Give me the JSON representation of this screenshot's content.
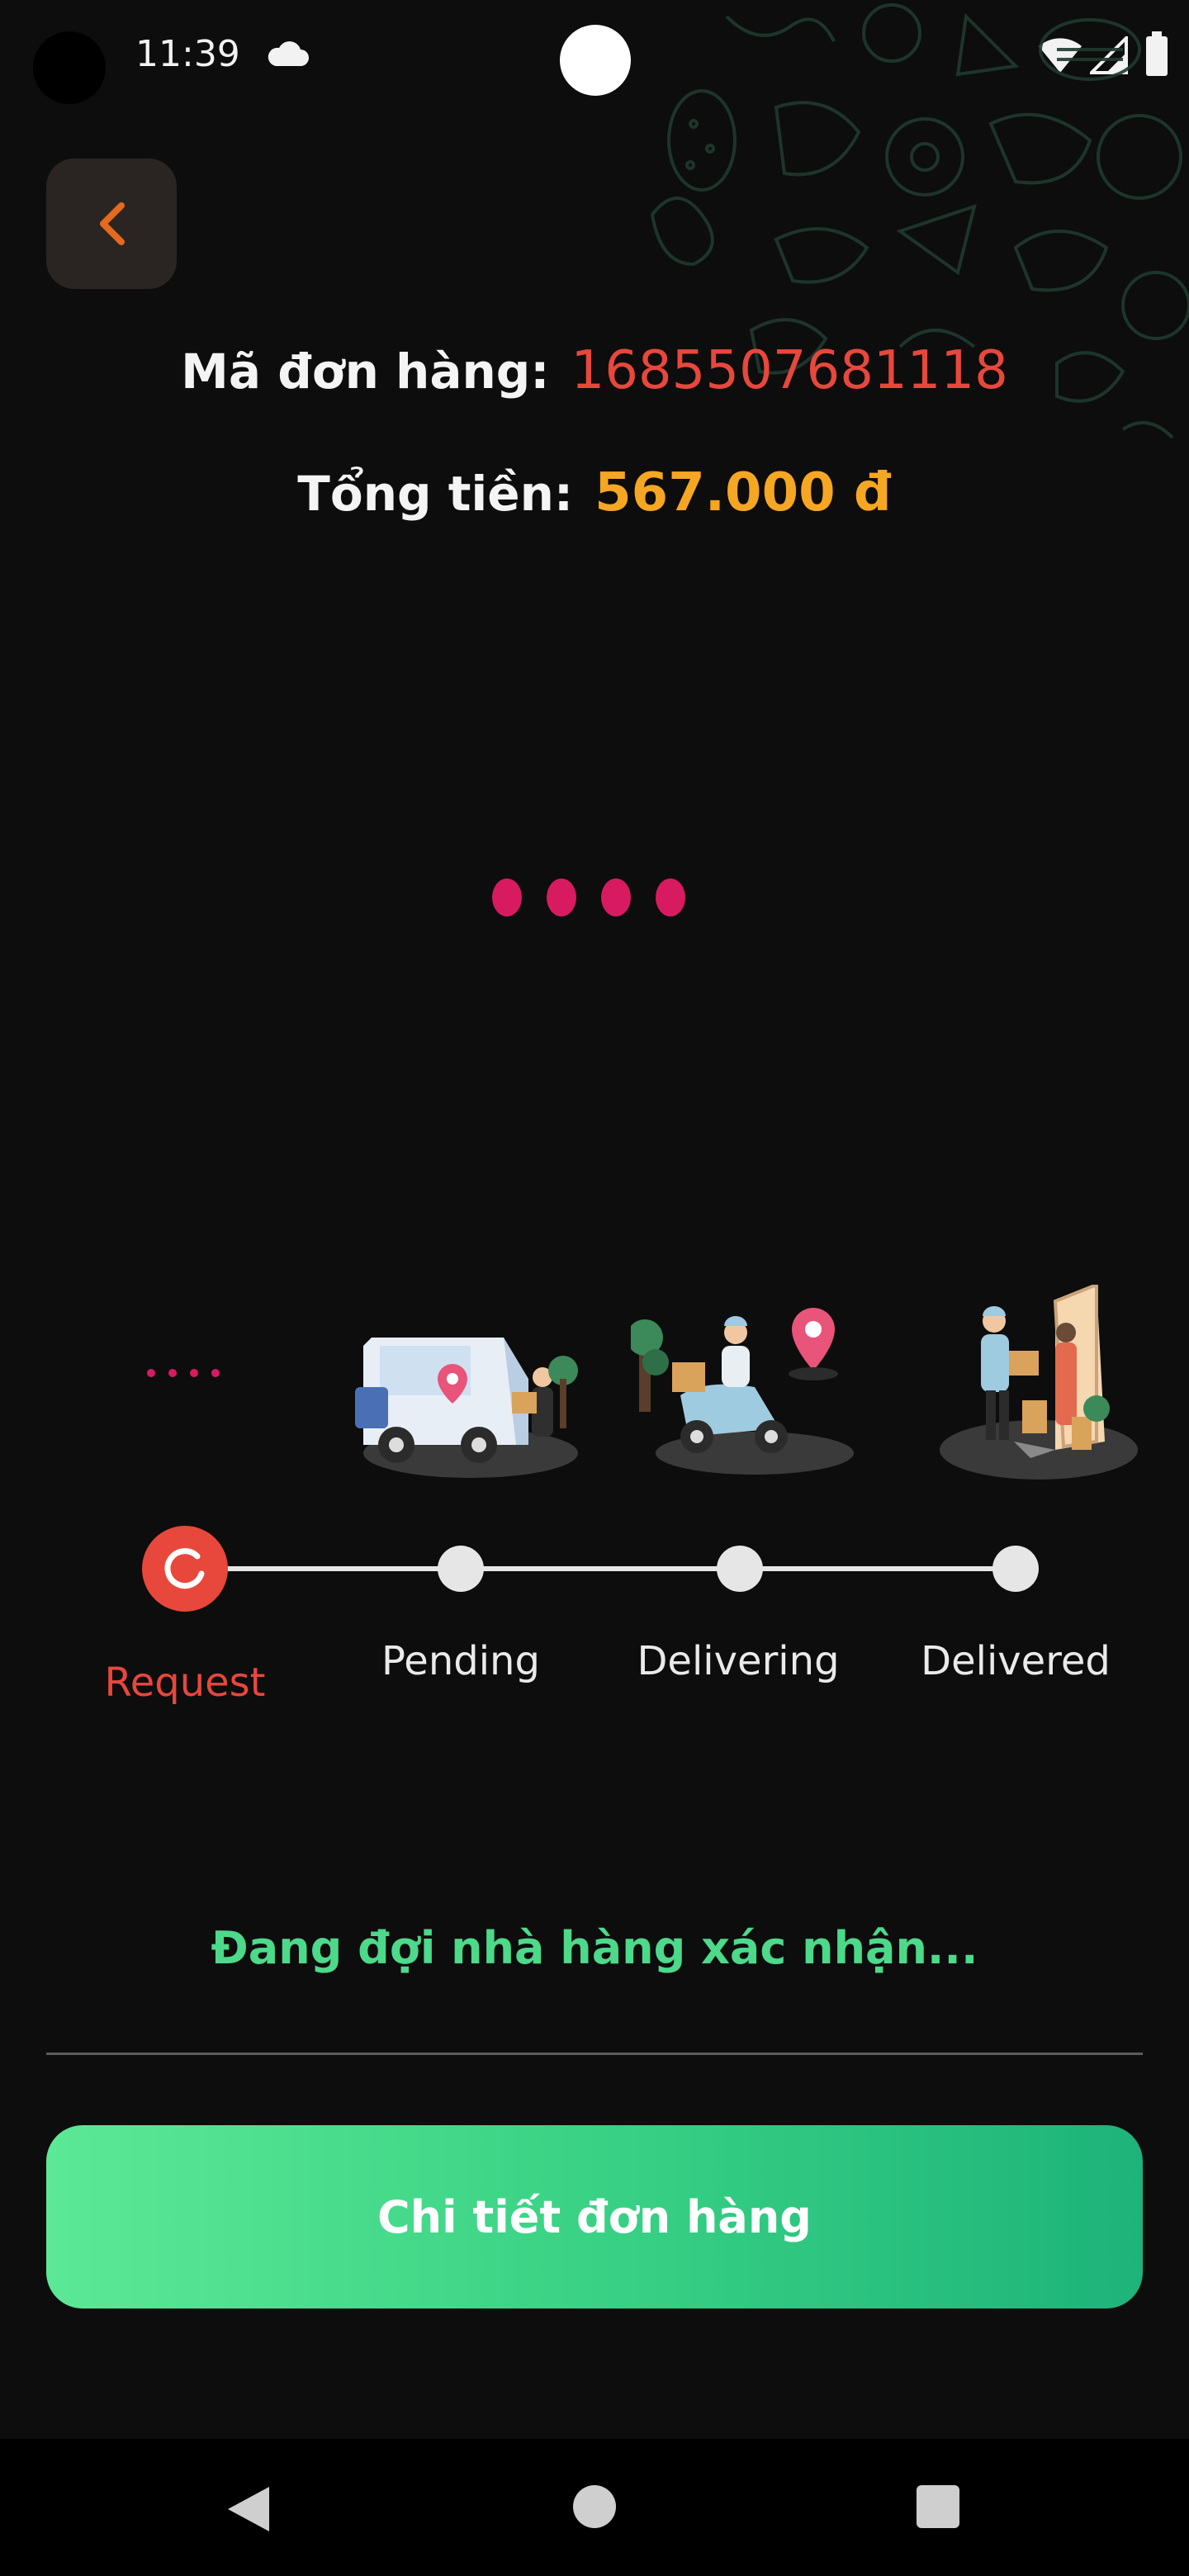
{
  "status_bar": {
    "time": "11:39",
    "icons": [
      "cloud-icon",
      "wifi-icon",
      "signal-icon",
      "battery-icon"
    ]
  },
  "header": {
    "back_icon": "chevron-left-icon"
  },
  "order": {
    "code_label": "Mã đơn hàng:",
    "code_value": "1685507681118",
    "total_label": "Tổng tiền:",
    "total_value": "567.000 đ"
  },
  "progress": {
    "steps": [
      {
        "label": "Request",
        "status": "current"
      },
      {
        "label": "Pending",
        "status": "upcoming"
      },
      {
        "label": "Delivering",
        "status": "upcoming"
      },
      {
        "label": "Delivered",
        "status": "upcoming"
      }
    ]
  },
  "status_message": "Đang đợi nhà hàng xác nhận...",
  "detail_button_label": "Chi tiết đơn hàng",
  "colors": {
    "accent_red": "#e8473c",
    "accent_orange": "#f5a623",
    "loader_pink": "#d81b60",
    "success_green": "#4cd98a",
    "button_gradient_start": "#5ce896",
    "button_gradient_end": "#1db37a"
  },
  "nav_bar": {
    "icons": [
      "nav-back-icon",
      "nav-home-icon",
      "nav-recents-icon"
    ]
  }
}
